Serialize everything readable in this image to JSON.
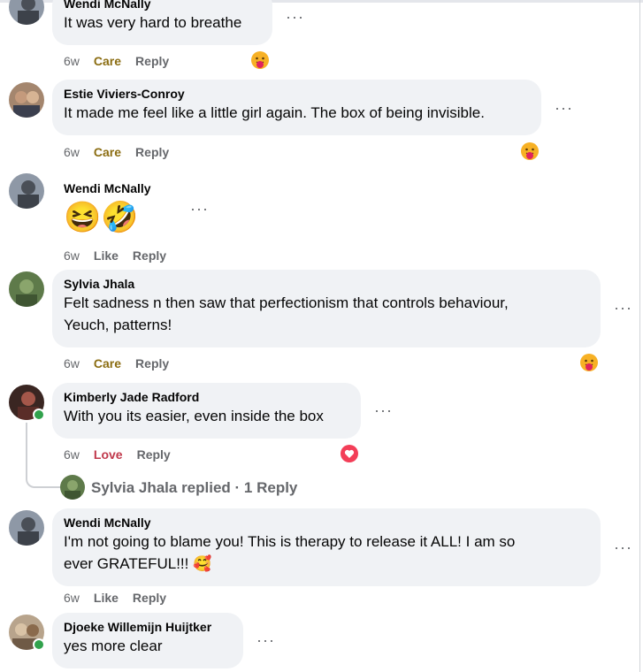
{
  "comments": [
    {
      "name": "Wendi McNally",
      "text": "It was very hard to breathe",
      "time": "6w",
      "reaction": "Care",
      "reply": "Reply",
      "reaction_emoji": "hugging-face-icon"
    },
    {
      "name": "Estie Viviers-Conroy",
      "text": "It made me feel like a little girl again. The box of being invisible.",
      "time": "6w",
      "reaction": "Care",
      "reply": "Reply",
      "reaction_emoji": "hugging-face-icon"
    },
    {
      "name": "Wendi McNally",
      "emojis": "😆🤣",
      "time": "6w",
      "reaction": "Like",
      "reply": "Reply"
    },
    {
      "name": "Sylvia Jhala",
      "text_line1": "Felt sadness n then saw that perfectionism that controls behaviour,",
      "text_line2": "Yeuch, patterns!",
      "time": "6w",
      "reaction": "Care",
      "reply": "Reply",
      "reaction_emoji": "hugging-face-icon"
    },
    {
      "name": "Kimberly Jade Radford",
      "text": "With you its easier, even inside the box",
      "time": "6w",
      "reaction": "Love",
      "reply": "Reply",
      "reaction_emoji": "heart-icon",
      "replied": "Sylvia Jhala replied · 1 Reply"
    },
    {
      "name": "Wendi McNally",
      "text_line1": "I'm not going to blame you! This is therapy to release it ALL! I am so",
      "text_line2": "ever GRATEFUL!!! 🥰",
      "time": "6w",
      "reaction": "Like",
      "reply": "Reply"
    },
    {
      "name": "Djoeke Willemijn Huijtker",
      "text": "yes more clear"
    }
  ],
  "more_glyph": "···",
  "colors": {
    "bubble": "#f0f2f5",
    "meta": "#65676b",
    "care": "#8b6d12",
    "love": "#c0384b",
    "online": "#31a24c"
  }
}
